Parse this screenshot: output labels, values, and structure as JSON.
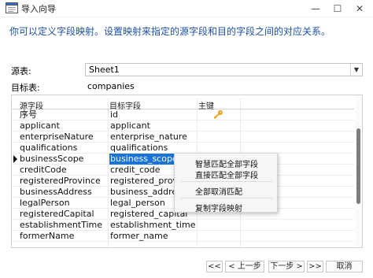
{
  "window": {
    "title": "导入向导",
    "controls": {
      "minimize": "—",
      "maximize": "☐",
      "close": "✕"
    }
  },
  "description": "你可以定义字段映射。设置映射来指定的源字段和目的字段之间的对应关系。",
  "source_table": {
    "label": "源表:",
    "value": "Sheet1"
  },
  "target_table": {
    "label": "目标表:",
    "value": "companies"
  },
  "grid": {
    "headers": {
      "source": "源字段",
      "target": "目标字段",
      "key": "主键"
    },
    "rows": [
      {
        "source": "序号",
        "target": "id",
        "key": "key-icon"
      },
      {
        "source": "applicant",
        "target": "applicant",
        "key": ""
      },
      {
        "source": "enterpriseNature",
        "target": "enterprise_nature",
        "key": ""
      },
      {
        "source": "qualifications",
        "target": "qualifications",
        "key": ""
      },
      {
        "source": "businessScope",
        "target": "business_scope",
        "key": "",
        "selected": true
      },
      {
        "source": "creditCode",
        "target": "credit_code",
        "key": ""
      },
      {
        "source": "registeredProvince",
        "target": "registered_province",
        "key": ""
      },
      {
        "source": "businessAddress",
        "target": "business_address",
        "key": ""
      },
      {
        "source": "legalPerson",
        "target": "legal_person",
        "key": ""
      },
      {
        "source": "registeredCapital",
        "target": "registered_capital",
        "key": ""
      },
      {
        "source": "establishmentTime",
        "target": "establishment_time",
        "key": ""
      },
      {
        "source": "formerName",
        "target": "former_name",
        "key": ""
      }
    ]
  },
  "context_menu": {
    "items": [
      "智慧匹配全部字段",
      "直接匹配全部字段",
      "全部取消匹配",
      "复制字段映射"
    ]
  },
  "footer": {
    "first_label": "<<",
    "prev_label": "< 上一步",
    "next_label": "下一步 >",
    "last_label": ">>",
    "cancel_label": "取消"
  },
  "colors": {
    "description": "#1c4fa5",
    "selection": "#1a73d9",
    "key_icon": "#e8a31d"
  }
}
